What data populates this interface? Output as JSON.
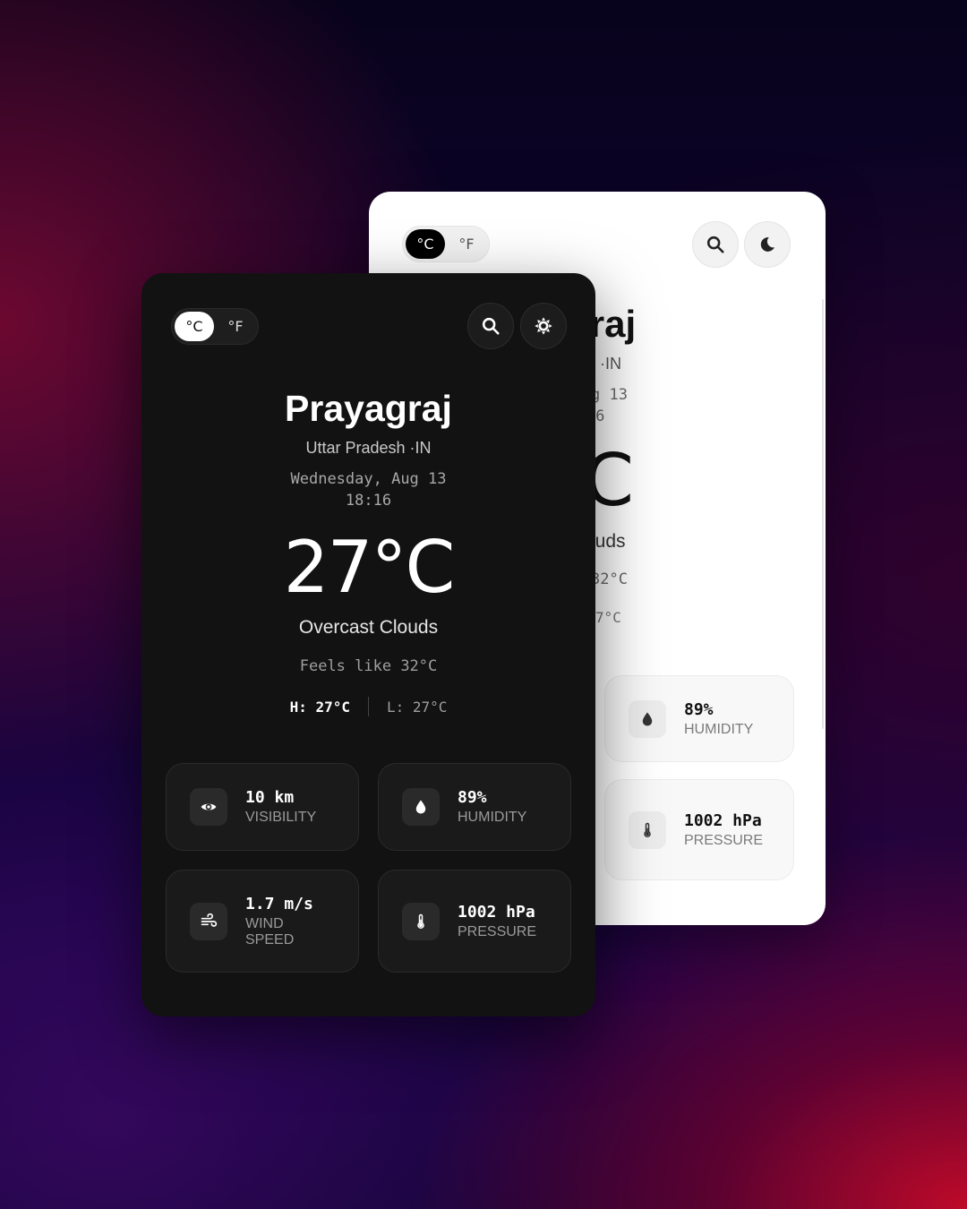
{
  "light_card": {
    "units": {
      "celsius": "°C",
      "fahrenheit": "°F",
      "selected": "°C"
    },
    "city": "agraj",
    "region": "desh ·IN",
    "date": ", Aug 13",
    "time": ":16",
    "temperature": "°C",
    "condition": "t Clouds",
    "feels_like": "ike 32°C",
    "low": "L: 27°C",
    "stats": [
      {
        "icon": "droplet-icon",
        "value": "89%",
        "label": "HUMIDITY"
      },
      {
        "icon": "thermometer-icon",
        "value": "1002 hPa",
        "label": "PRESSURE"
      }
    ]
  },
  "dark_card": {
    "units": {
      "celsius": "°C",
      "fahrenheit": "°F",
      "selected": "°C"
    },
    "city": "Prayagraj",
    "region": "Uttar Pradesh ·IN",
    "date": "Wednesday, Aug 13",
    "time": "18:16",
    "temperature": "27°C",
    "condition": "Overcast Clouds",
    "feels_like": "Feels like 32°C",
    "high": "H: 27°C",
    "low": "L: 27°C",
    "stats": [
      {
        "icon": "eye-icon",
        "value": "10 km",
        "label": "VISIBILITY"
      },
      {
        "icon": "droplet-icon",
        "value": "89%",
        "label": "HUMIDITY"
      },
      {
        "icon": "wind-icon",
        "value": "1.7 m/s",
        "label": "WIND\nSPEED"
      },
      {
        "icon": "thermometer-icon",
        "value": "1002 hPa",
        "label": "PRESSURE"
      }
    ]
  },
  "colors": {
    "dark_bg": "#121212",
    "light_bg": "#ffffff",
    "accent_red": "#c80a28",
    "accent_purple": "#1c0448"
  }
}
